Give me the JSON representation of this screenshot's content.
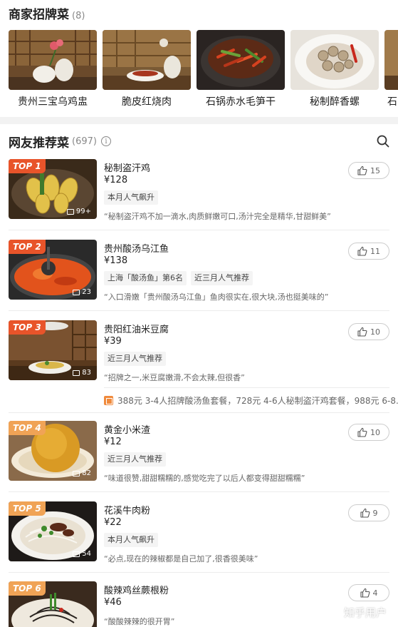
{
  "signature": {
    "title": "商家招牌菜",
    "count": "(8)",
    "items": [
      {
        "name": "贵州三宝乌鸡盅",
        "icon": "food-photo"
      },
      {
        "name": "脆皮红烧肉",
        "icon": "food-photo"
      },
      {
        "name": "石锅赤水毛笋干",
        "icon": "food-photo"
      },
      {
        "name": "秘制醉香螺",
        "icon": "food-photo"
      },
      {
        "name": "石",
        "icon": "food-photo"
      }
    ]
  },
  "recommended": {
    "title": "网友推荐菜",
    "count": "(697)",
    "info_icon": "i",
    "dishes": [
      {
        "rank": "TOP 1",
        "name": "秘制盗汗鸡",
        "price": "¥128",
        "tags": [
          "本月人气飙升"
        ],
        "quote": "“秘制盗汗鸡不加一滴水,肉质鲜嫩可口,汤汁完全是精华,甘甜鲜美”",
        "photos": "99+",
        "likes": "15"
      },
      {
        "rank": "TOP 2",
        "name": "贵州酸汤乌江鱼",
        "price": "¥138",
        "tags": [
          "上海「酸汤鱼」第6名",
          "近三月人气推荐"
        ],
        "quote": "“入口滑嫩「贵州酸汤乌江鱼」鱼肉很实在,很大块,汤也挺美味的”",
        "photos": "23",
        "likes": "11"
      },
      {
        "rank": "TOP 3",
        "name": "贵阳红油米豆腐",
        "price": "¥39",
        "tags": [
          "近三月人气推荐"
        ],
        "quote": "“招牌之一,米豆腐嫩滑,不会太辣,但很香”",
        "photos": "83",
        "likes": "10"
      },
      {
        "rank": "TOP 4",
        "name": "黄金小米渣",
        "price": "¥12",
        "tags": [
          "近三月人气推荐"
        ],
        "quote": "“味道很赞,甜甜糯糯的,感觉吃完了以后人都变得甜甜糯糯”",
        "photos": "82",
        "likes": "10"
      },
      {
        "rank": "TOP 5",
        "name": "花溪牛肉粉",
        "price": "¥22",
        "tags": [
          "本月人气飙升"
        ],
        "quote": "“必点,现在的辣椒都是自己加了,很香很美味”",
        "photos": "54",
        "likes": "9"
      },
      {
        "rank": "TOP 6",
        "name": "酸辣鸡丝蕨根粉",
        "price": "¥46",
        "tags": [],
        "quote": "“酸酸辣辣的很开胃”",
        "photos": "",
        "likes": "4"
      }
    ],
    "combo_text": "388元 3-4人招牌酸汤鱼套餐，728元 4-6人秘制盗汗鸡套餐，988元 6-8..."
  },
  "watermark": "知乎用户"
}
